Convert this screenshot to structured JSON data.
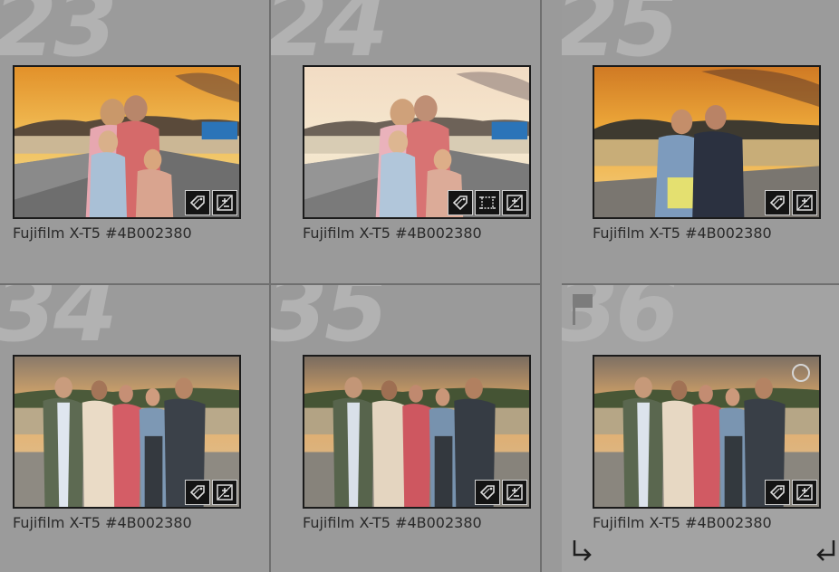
{
  "cells": [
    {
      "index": "23",
      "caption": "Fujifilm X-T5 #4B002380",
      "scene": "sunset-family-bridge",
      "badges": [
        "tag-icon",
        "adjust-icon"
      ]
    },
    {
      "index": "24",
      "caption": "Fujifilm X-T5 #4B002380",
      "scene": "family-bridge-bright",
      "badges": [
        "tag-icon",
        "crop-icon",
        "adjust-icon"
      ]
    },
    {
      "index": "25",
      "caption": "Fujifilm X-T5 #4B002380",
      "scene": "couple-sunset",
      "badges": [
        "tag-icon",
        "adjust-icon"
      ]
    },
    {
      "index": "34",
      "caption": "Fujifilm X-T5 #4B002380",
      "scene": "group-five-harbour",
      "badges": [
        "tag-icon",
        "adjust-icon"
      ]
    },
    {
      "index": "35",
      "caption": "Fujifilm X-T5 #4B002380",
      "scene": "group-five-harbour",
      "badges": [
        "tag-icon",
        "adjust-icon"
      ]
    },
    {
      "index": "36",
      "caption": "Fujifilm X-T5 #4B002380",
      "scene": "group-five-harbour",
      "badges": [
        "tag-icon",
        "adjust-icon"
      ],
      "flag": "flag-icon",
      "selected_circle": true,
      "rotate_controls": [
        "rotate-left-icon",
        "rotate-right-icon"
      ]
    }
  ],
  "colors": {
    "cell_bg": "#9b9b9b",
    "cell_border": "#6f6f6f",
    "index_number": "#b2b2b2",
    "caption_text": "#2a2a2a",
    "thumb_border": "#1b1b1b"
  }
}
